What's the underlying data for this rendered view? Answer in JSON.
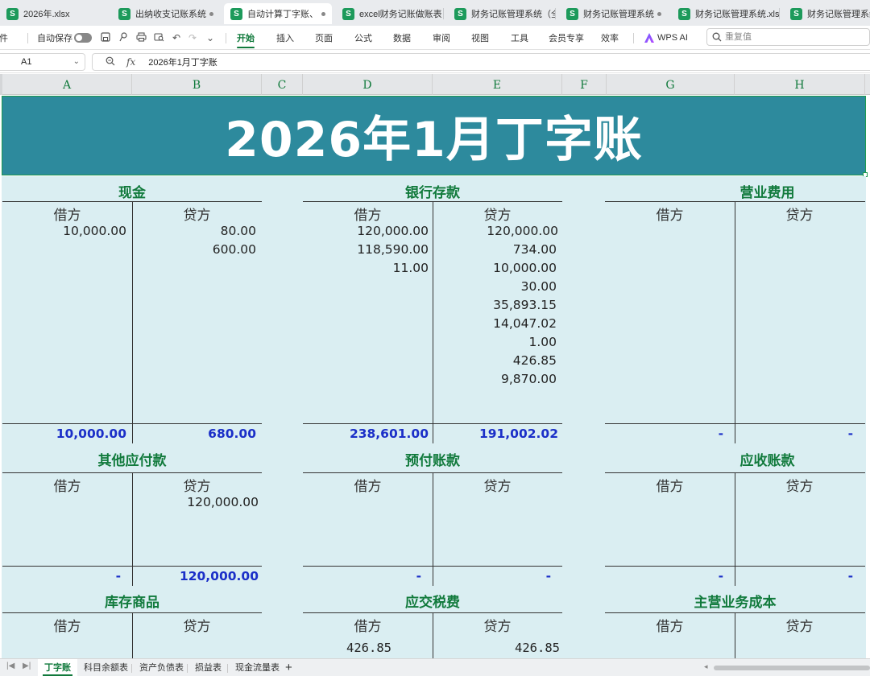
{
  "tabs": [
    {
      "label": "2026年.xlsx",
      "active": false,
      "dot": false
    },
    {
      "label": "出纳收支记账系统（",
      "active": false,
      "dot": true
    },
    {
      "label": "自动计算丁字账、余",
      "active": true,
      "dot": true
    },
    {
      "label": "excel财务记账做账表",
      "active": false,
      "dot": false
    },
    {
      "label": "财务记账管理系统（全",
      "active": false,
      "dot": false
    },
    {
      "label": "财务记账管理系统（",
      "active": false,
      "dot": true
    },
    {
      "label": "财务记账管理系统.xls",
      "active": false,
      "dot": false
    },
    {
      "label": "财务记账管理系统",
      "active": false,
      "dot": false
    }
  ],
  "ribbon": {
    "file_label": "文件",
    "autosave_label": "自动保存",
    "menus": [
      "开始",
      "插入",
      "页面",
      "公式",
      "数据",
      "审阅",
      "视图",
      "工具",
      "会员专享",
      "效率"
    ],
    "selected_menu": "开始",
    "wps_ai_label": "WPS AI",
    "search_placeholder": "重复值"
  },
  "formula_bar": {
    "cell_ref": "A1",
    "fx_label": "fx",
    "formula_value": "2026年1月丁字账"
  },
  "sheet": {
    "columns": [
      "A",
      "B",
      "C",
      "D",
      "E",
      "F",
      "G",
      "H"
    ],
    "banner_title": "2026年1月丁字账",
    "debit_label": "借方",
    "credit_label": "贷方",
    "accounts": [
      {
        "name": "现金",
        "debit": [
          "10,000.00"
        ],
        "credit": [
          "80.00",
          "600.00"
        ],
        "total_debit": "10,000.00",
        "total_credit": "680.00"
      },
      {
        "name": "银行存款",
        "debit": [
          "120,000.00",
          "118,590.00",
          "11.00"
        ],
        "credit": [
          "120,000.00",
          "734.00",
          "10,000.00",
          "30.00",
          "35,893.15",
          "14,047.02",
          "1.00",
          "426.85",
          "9,870.00"
        ],
        "total_debit": "238,601.00",
        "total_credit": "191,002.02"
      },
      {
        "name": "营业费用",
        "debit": [],
        "credit": [],
        "total_debit": "-",
        "total_credit": "-"
      },
      {
        "name": "其他应付款",
        "debit": [],
        "credit": [
          "120,000.00"
        ],
        "total_debit": "-",
        "total_credit": "120,000.00"
      },
      {
        "name": "预付账款",
        "debit": [],
        "credit": [],
        "total_debit": "-",
        "total_credit": "-"
      },
      {
        "name": "应收账款",
        "debit": [],
        "credit": [],
        "total_debit": "-",
        "total_credit": "-"
      },
      {
        "name": "库存商品",
        "debit": [],
        "credit": [],
        "total_debit": "",
        "total_credit": ""
      },
      {
        "name": "应交税费",
        "debit": [
          "426.85"
        ],
        "credit": [
          "426.85"
        ],
        "total_debit": "",
        "total_credit": ""
      },
      {
        "name": "主营业务成本",
        "debit": [],
        "credit": [],
        "total_debit": "",
        "total_credit": ""
      }
    ]
  },
  "sheet_tabs": [
    "丁字账",
    "科目余额表",
    "资产负债表",
    "损益表",
    "现金流量表"
  ],
  "active_sheet_tab": "丁字账",
  "colors": {
    "accent_green": "#117a3c",
    "banner_bg": "#2d8a9d",
    "sheet_bg": "#daeef2",
    "total_blue": "#1b2fc8",
    "tab_icon_green": "#1d9a5b"
  }
}
